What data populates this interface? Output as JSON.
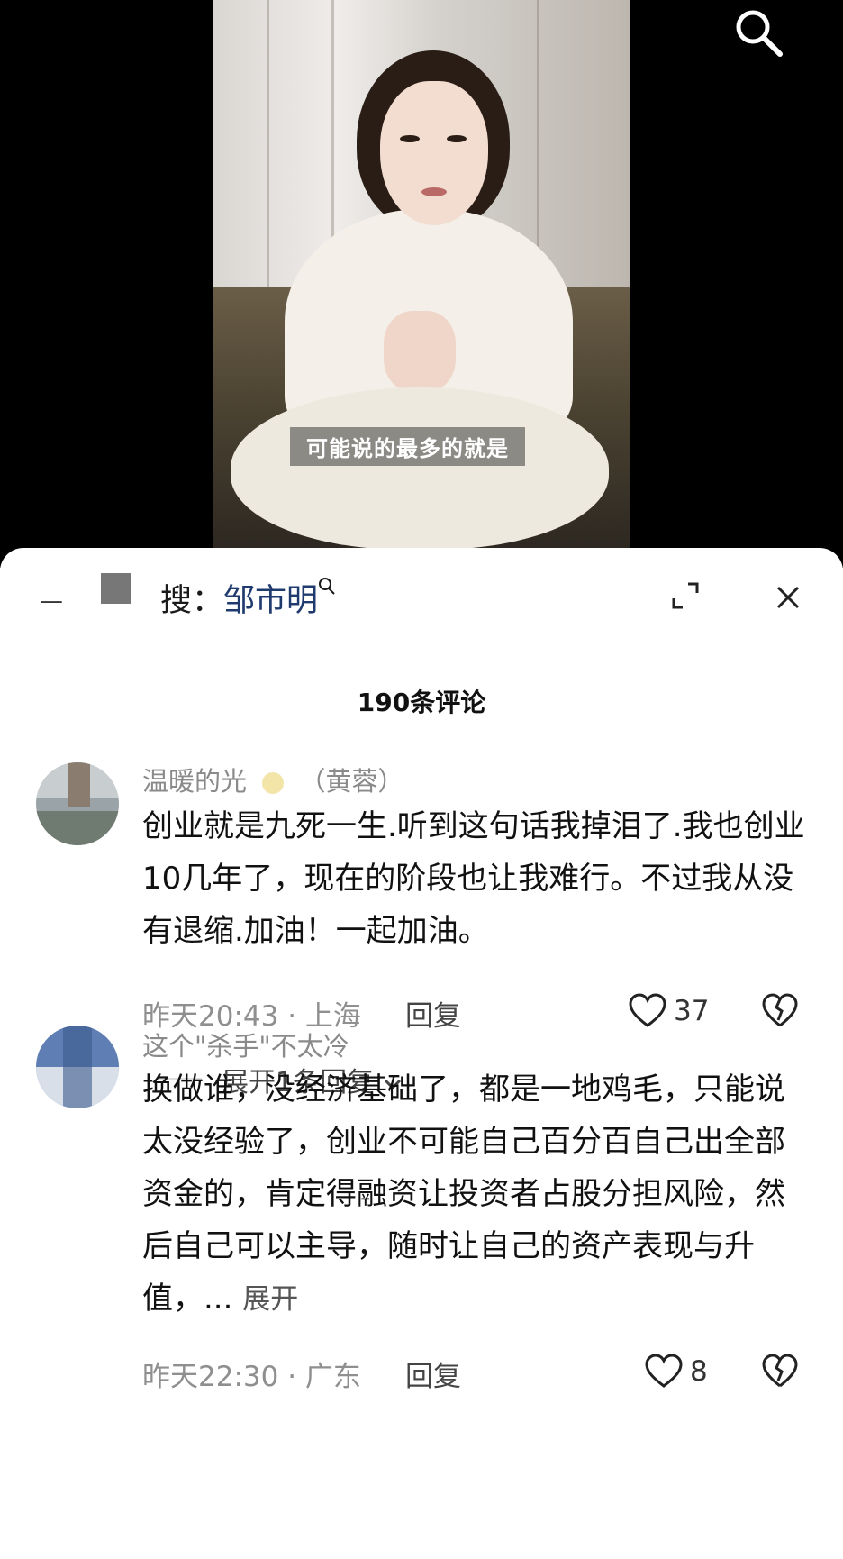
{
  "video": {
    "subtitle": "可能说的最多的就是",
    "search_icon": "search-icon"
  },
  "header": {
    "dash": "—",
    "search_prefix": "搜：",
    "search_keyword": "邹市明",
    "search_glass": "search-small-icon",
    "expand_icon": "expand-icon",
    "close_icon": "close-icon"
  },
  "comments_header": {
    "count_title": "190条评论"
  },
  "comments": [
    {
      "username": "温暖的光",
      "username_suffix": "（黄蓉）",
      "text": "创业就是九死一生.听到这句话我掉泪了.我也创业10几年了，现在的阶段也让我难行。不过我从没有退缩.加油！一起加油。",
      "time": "昨天20:43",
      "location": "上海",
      "reply_label": "回复",
      "likes": "37",
      "expand_replies": "展开1条回复"
    },
    {
      "username": "这个\"杀手\"不太冷",
      "text": "换做谁，没经济基础了，都是一地鸡毛，只能说太没经验了，创业不可能自己百分百自己出全部资金的，肯定得融资让投资者占股分担风险，然后自己可以主导，随时让自己的资产表现与升值，...",
      "more_label": "展开",
      "time": "昨天22:30",
      "location": "广东",
      "reply_label": "回复",
      "likes": "8"
    }
  ],
  "separator": " · ",
  "colors": {
    "meta": "#8f8f8f",
    "keyword": "#1f3a6e",
    "background": "#ffffff"
  }
}
